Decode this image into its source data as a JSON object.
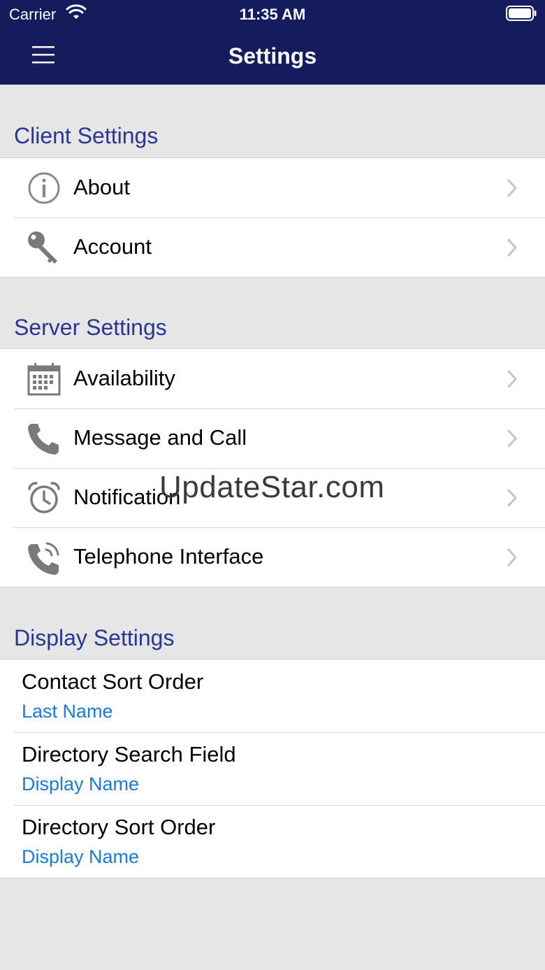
{
  "status_bar": {
    "carrier": "Carrier",
    "time": "11:35 AM"
  },
  "nav": {
    "title": "Settings",
    "menu_icon": "hamburger-icon"
  },
  "sections": {
    "client": {
      "title": "Client Settings",
      "items": [
        {
          "label": "About",
          "icon": "info-icon"
        },
        {
          "label": "Account",
          "icon": "key-icon"
        }
      ]
    },
    "server": {
      "title": "Server Settings",
      "items": [
        {
          "label": "Availability",
          "icon": "calendar-icon"
        },
        {
          "label": "Message and Call",
          "icon": "phone-icon"
        },
        {
          "label": "Notification",
          "icon": "alarm-clock-icon"
        },
        {
          "label": "Telephone Interface",
          "icon": "phone-ringing-icon"
        }
      ]
    },
    "display": {
      "title": "Display Settings",
      "items": [
        {
          "title": "Contact Sort Order",
          "value": "Last Name"
        },
        {
          "title": "Directory Search Field",
          "value": "Display Name"
        },
        {
          "title": "Directory Sort Order",
          "value": "Display Name"
        }
      ]
    }
  },
  "watermark": "UpdateStar.com",
  "colors": {
    "nav_background": "#141c5e",
    "section_header": "#2a3595",
    "value_text": "#1a7ae0",
    "page_background": "#e6e6e6"
  }
}
